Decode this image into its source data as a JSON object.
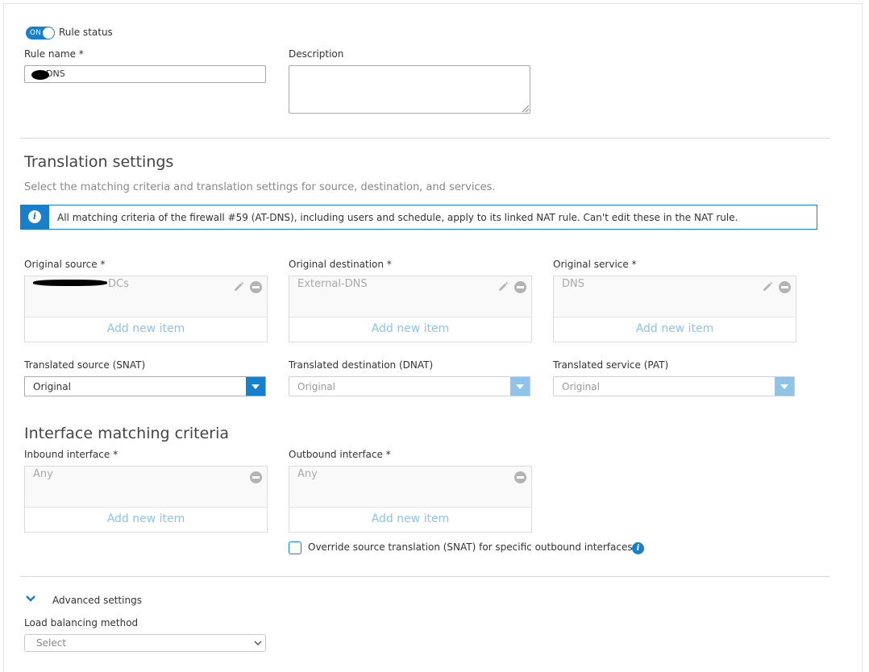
{
  "rule_status": {
    "toggle_label": "ON",
    "label": "Rule status"
  },
  "rule_name": {
    "label": "Rule name *",
    "value": "DNS"
  },
  "description": {
    "label": "Description",
    "value": ""
  },
  "translation": {
    "title": "Translation settings",
    "subtitle": "Select the matching criteria and translation settings for source, destination, and services.",
    "info": "All matching criteria of the firewall #59 (AT-DNS), including users and schedule, apply to its linked NAT rule. Can't edit these in the NAT rule."
  },
  "original_source": {
    "label": "Original source *",
    "item": "DCs",
    "add": "Add new item"
  },
  "original_destination": {
    "label": "Original destination *",
    "item": "External-DNS",
    "add": "Add new item"
  },
  "original_service": {
    "label": "Original service *",
    "item": "DNS",
    "add": "Add new item"
  },
  "translated_source": {
    "label": "Translated source (SNAT)",
    "value": "Original"
  },
  "translated_destination": {
    "label": "Translated destination (DNAT)",
    "value": "Original"
  },
  "translated_service": {
    "label": "Translated service (PAT)",
    "value": "Original"
  },
  "interface": {
    "title": "Interface matching criteria",
    "inbound": {
      "label": "Inbound interface *",
      "item": "Any",
      "add": "Add new item"
    },
    "outbound": {
      "label": "Outbound interface *",
      "item": "Any",
      "add": "Add new item"
    },
    "override_label": "Override source translation (SNAT) for specific outbound interfaces"
  },
  "advanced": {
    "title": "Advanced settings",
    "load_balancing_label": "Load balancing method",
    "load_balancing_value": "Select"
  },
  "colors": {
    "accent": "#1a7fc9",
    "accent_light": "#8fc3e8"
  },
  "icons": [
    "info-icon",
    "pencil-icon",
    "minus-circle-icon",
    "chevron-down-icon"
  ]
}
